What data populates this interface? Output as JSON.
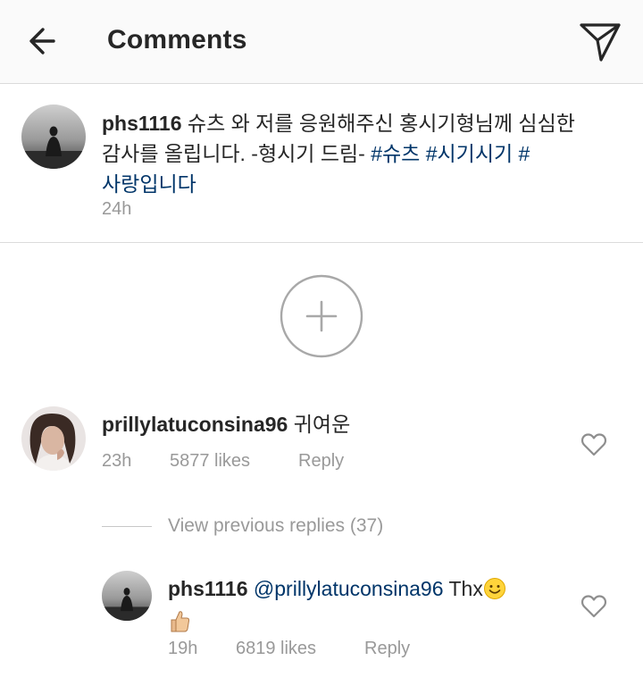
{
  "header": {
    "title": "Comments",
    "back_icon": "arrow-left-icon",
    "send_icon": "direct-send-icon"
  },
  "caption": {
    "username": "phs1116",
    "text": " 슈츠 와 저를 응원해주신 홍시기형님께 심심한 감사를 올립니다. -형시기 드림- ",
    "hashtags": [
      "#슈츠",
      "#시기시기",
      "#사랑입니다"
    ],
    "time": "24h"
  },
  "add_button": {
    "icon": "plus-circle-icon"
  },
  "comments": [
    {
      "username": "prillylatuconsina96",
      "text": " 귀여운",
      "time": "23h",
      "likes": "5877 likes",
      "reply": "Reply"
    }
  ],
  "view_replies": "View previous replies (37)",
  "replies": [
    {
      "username": "phs1116",
      "mention": "@prillylatuconsina96",
      "text": " Thx",
      "emojis": [
        "slightly-smiling-face-emoji",
        "thumbs-up-emoji"
      ],
      "time": "19h",
      "likes": "6819 likes",
      "reply": "Reply"
    }
  ],
  "colors": {
    "text": "#262626",
    "secondary": "#999999",
    "link": "#003569",
    "divider": "#dbdbdb",
    "header_bg": "#fafafa"
  }
}
